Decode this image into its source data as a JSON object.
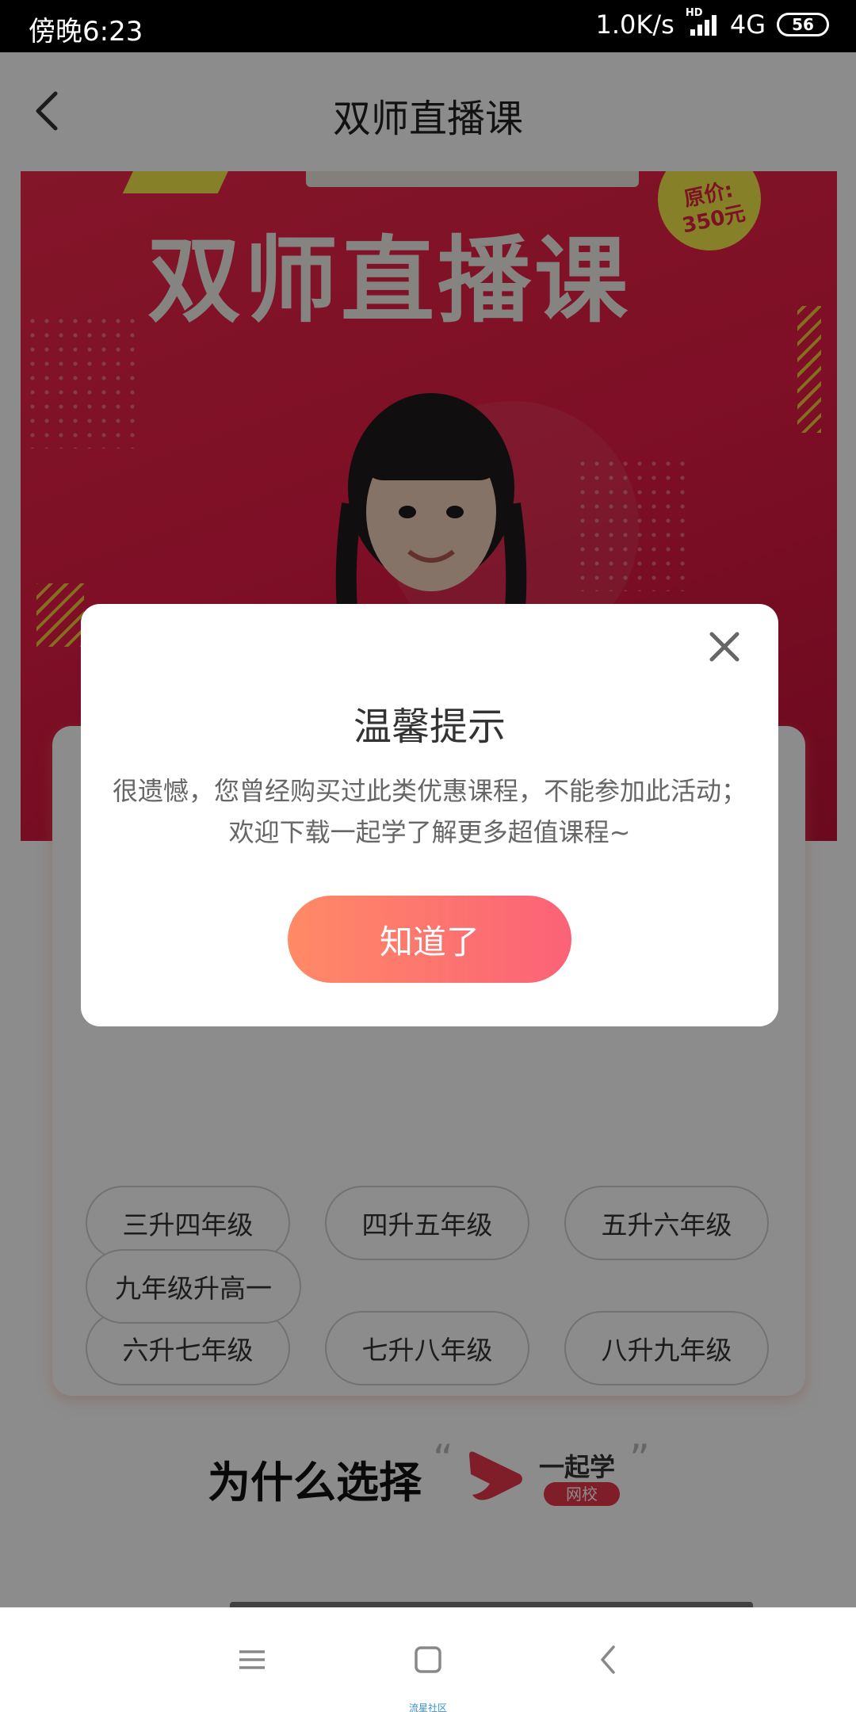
{
  "status_bar": {
    "time": "傍晚6:23",
    "network_speed": "1.0K/s",
    "signal_tag": "HD",
    "network_type": "4G",
    "battery": "56"
  },
  "header": {
    "title": "双师直播课",
    "back_icon": "chevron-left-icon"
  },
  "banner": {
    "headline": "双师直播课",
    "price_badge_line1": "原价:",
    "price_badge_line2": "350元",
    "colors": {
      "background": "#e51c45",
      "accent": "#f5e94b"
    }
  },
  "grades": [
    "三升四年级",
    "四升五年级",
    "五升六年级",
    "六升七年级",
    "七升八年级",
    "八升九年级",
    "九年级升高一"
  ],
  "why_section": {
    "title": "为什么选择",
    "quote_open": "“",
    "quote_close": "”",
    "brand_name": "一起学",
    "brand_sub": "网校"
  },
  "dialog": {
    "title": "温馨提示",
    "message": "很遗憾，您曾经购买过此类优惠课程，不能参加此活动；欢迎下载一起学了解更多超值课程~",
    "confirm_label": "知道了",
    "close_icon": "close-icon",
    "button_color": "#fb6277"
  },
  "nav_bar": {
    "caption": "流星社区",
    "icons": [
      "menu-icon",
      "home-icon",
      "back-icon"
    ]
  }
}
